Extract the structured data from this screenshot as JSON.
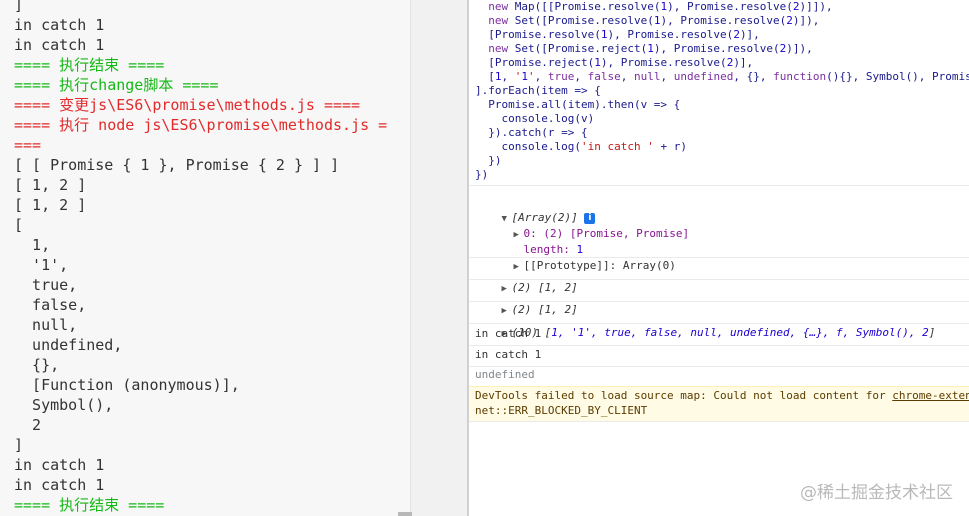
{
  "terminal": {
    "lines": [
      {
        "text": "]",
        "color": "default"
      },
      {
        "text": "in catch 1",
        "color": "default"
      },
      {
        "text": "in catch 1",
        "color": "default"
      },
      {
        "text": "==== 执行结束 ====",
        "color": "green"
      },
      {
        "text": "==== 执行change脚本 ====",
        "color": "green"
      },
      {
        "text": "==== 变更js\\ES6\\promise\\methods.js ====",
        "color": "red"
      },
      {
        "text": "==== 执行 node js\\ES6\\promise\\methods.js =",
        "color": "red"
      },
      {
        "text": "===",
        "color": "red"
      },
      {
        "text": "[ [ Promise { 1 }, Promise { 2 } ] ]",
        "color": "default"
      },
      {
        "text": "[ 1, 2 ]",
        "color": "default"
      },
      {
        "text": "[ 1, 2 ]",
        "color": "default"
      },
      {
        "text": "[",
        "color": "default"
      },
      {
        "text": "  1,",
        "color": "default"
      },
      {
        "text": "  '1',",
        "color": "default"
      },
      {
        "text": "  true,",
        "color": "default"
      },
      {
        "text": "  false,",
        "color": "default"
      },
      {
        "text": "  null,",
        "color": "default"
      },
      {
        "text": "  undefined,",
        "color": "default"
      },
      {
        "text": "  {},",
        "color": "default"
      },
      {
        "text": "  [Function (anonymous)],",
        "color": "default"
      },
      {
        "text": "  Symbol(),",
        "color": "default"
      },
      {
        "text": "  2",
        "color": "default"
      },
      {
        "text": "]",
        "color": "default"
      },
      {
        "text": "in catch 1",
        "color": "default"
      },
      {
        "text": "in catch 1",
        "color": "default"
      },
      {
        "text": "==== 执行结束 ====",
        "color": "green"
      }
    ]
  },
  "console": {
    "code_lines": [
      "  new Map([[Promise.resolve(1), Promise.resolve(2)]]),",
      "  new Set([Promise.resolve(1), Promise.resolve(2)]),",
      "  [Promise.resolve(1), Promise.resolve(2)],",
      "  new Set([Promise.reject(1), Promise.resolve(2)]),",
      "  [Promise.reject(1), Promise.resolve(2)],",
      "  [1, '1', true, false, null, undefined, {}, function(){}, Symbol(), Promis",
      "].forEach(item => {",
      "  Promise.all(item).then(v => {",
      "    console.log(v)",
      "  }).catch(r => {",
      "    console.log('in catch ' + r)",
      "  })",
      "})"
    ],
    "array_header": "[Array(2)]",
    "info_badge": "i",
    "array_item0": "0: (2) [Promise, Promise]",
    "array_length_key": "length:",
    "array_length_val": "1",
    "array_proto": "[[Prototype]]: Array(0)",
    "out1": "(2) [1, 2]",
    "out2": "(2) [1, 2]",
    "out3_prefix": "(10) [",
    "out3_items": "1, '1', true, false, null, undefined, {…}, f, Symbol(), 2",
    "out3_suffix": "]",
    "catch1": "in catch 1",
    "catch2": "in catch 1",
    "undefined_text": "undefined",
    "warn_text": "DevTools failed to load source map: Could not load content for ",
    "warn_link": "chrome-exten",
    "warn_line2": "net::ERR_BLOCKED_BY_CLIENT"
  },
  "watermark": "@稀土掘金技术社区",
  "colors": {
    "green": "#16b816",
    "red": "#e22a2a",
    "warn_bg": "#fffbe5"
  }
}
